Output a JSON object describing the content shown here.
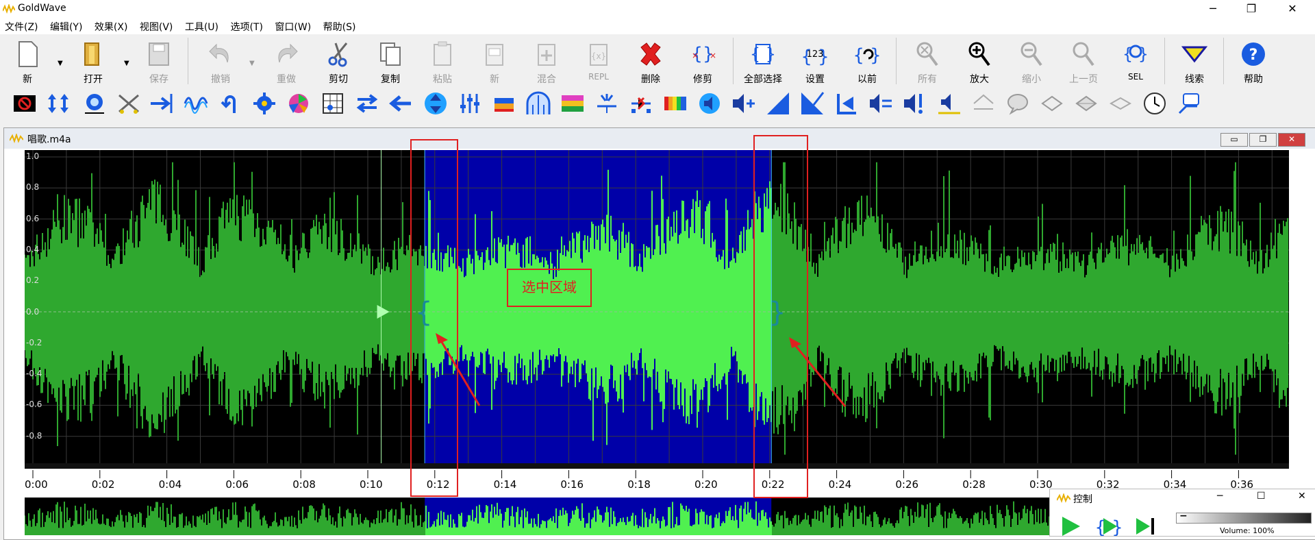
{
  "app": {
    "title": "GoldWave"
  },
  "menu": [
    "文件(Z)",
    "编辑(Y)",
    "效果(X)",
    "视图(V)",
    "工具(U)",
    "选项(T)",
    "窗口(W)",
    "帮助(S)"
  ],
  "toolbar": {
    "new": "新",
    "open": "打开",
    "save": "保存",
    "undo": "撤销",
    "redo": "重做",
    "cut": "剪切",
    "copy": "复制",
    "paste": "粘贴",
    "paste_new": "新",
    "mix": "混合",
    "repl": "REPL",
    "delete": "删除",
    "trim": "修剪",
    "select_all": "全部选择",
    "set": "设置",
    "previous": "以前",
    "all": "所有",
    "zoom_in": "放大",
    "zoom_out": "缩小",
    "prev_page": "上一页",
    "sel": "SEL",
    "cue": "线索",
    "help": "帮助"
  },
  "document": {
    "title": "唱歌.m4a"
  },
  "waveform": {
    "y_labels": [
      "1.0",
      "0.8",
      "0.6",
      "0.4",
      "0.2",
      "0.0",
      "-0.2",
      "-0.4",
      "-0.6",
      "-0.8"
    ],
    "time_labels": [
      "0:00",
      "0:02",
      "0:04",
      "0:06",
      "0:08",
      "0:10",
      "0:12",
      "0:14",
      "0:16",
      "0:18",
      "0:20",
      "0:22",
      "0:24",
      "0:26",
      "0:28",
      "0:30",
      "0:32",
      "0:34",
      "0:36"
    ],
    "selection_label": "选中区域",
    "colors": {
      "wave": "#2fa82f",
      "selected_wave": "#50f050",
      "selection_bg": "#0000a8",
      "background": "#000000",
      "annotation": "#e02020"
    }
  },
  "control": {
    "title": "控制",
    "volume": "Volume: 100%"
  }
}
